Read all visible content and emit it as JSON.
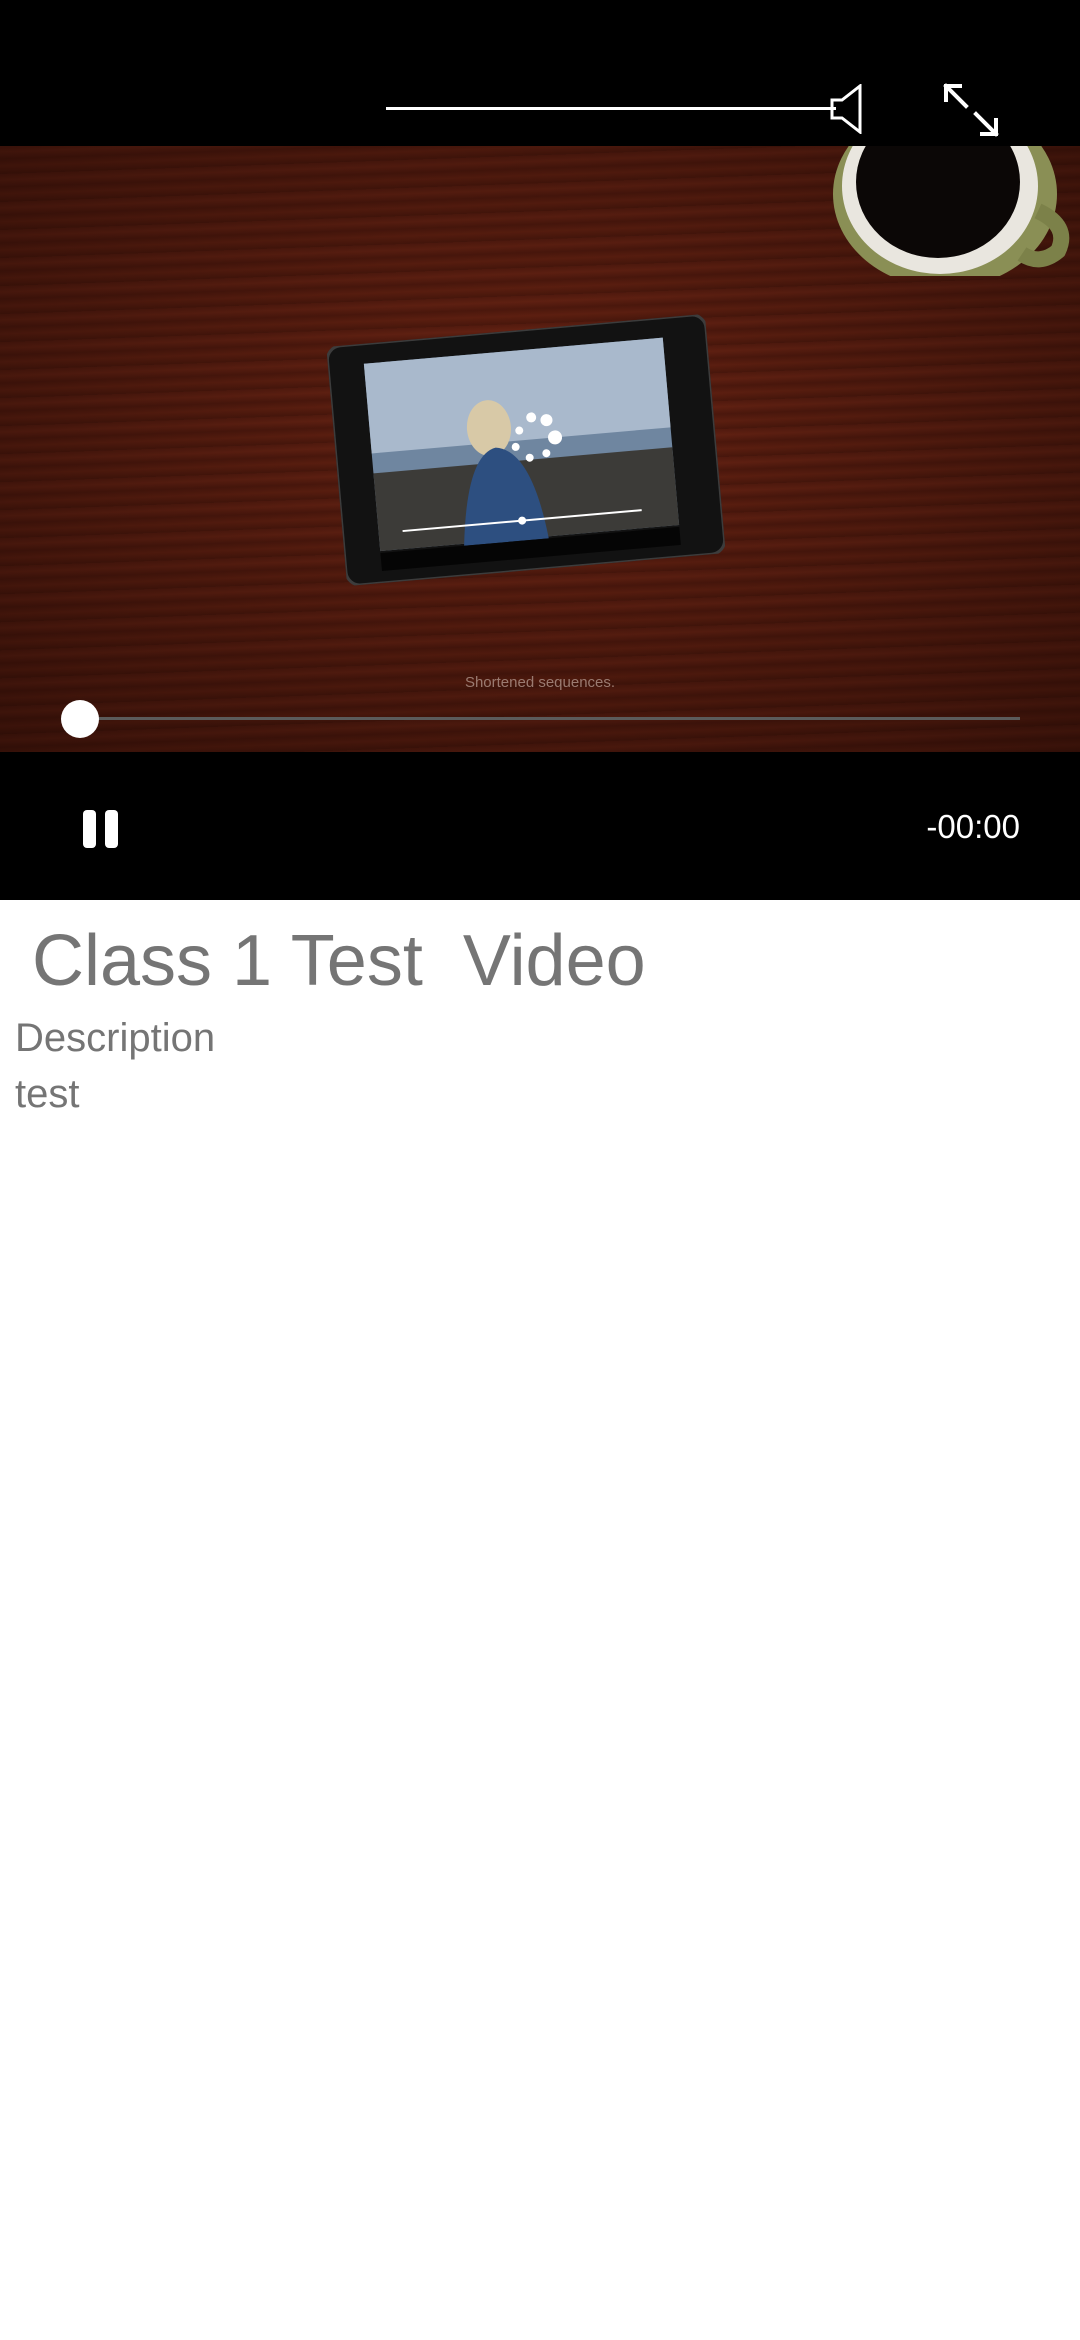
{
  "player": {
    "video_caption": "Shortened sequences.",
    "time_remaining": "-00:00",
    "seek_progress": 0.0,
    "volume_level": 1.0
  },
  "content": {
    "title": "Class 1 Test  Video",
    "description_label": "Description",
    "description_text": "test"
  },
  "icons": {
    "volume": "volume-icon",
    "fullscreen": "fullscreen-icon",
    "pause": "pause-icon"
  }
}
